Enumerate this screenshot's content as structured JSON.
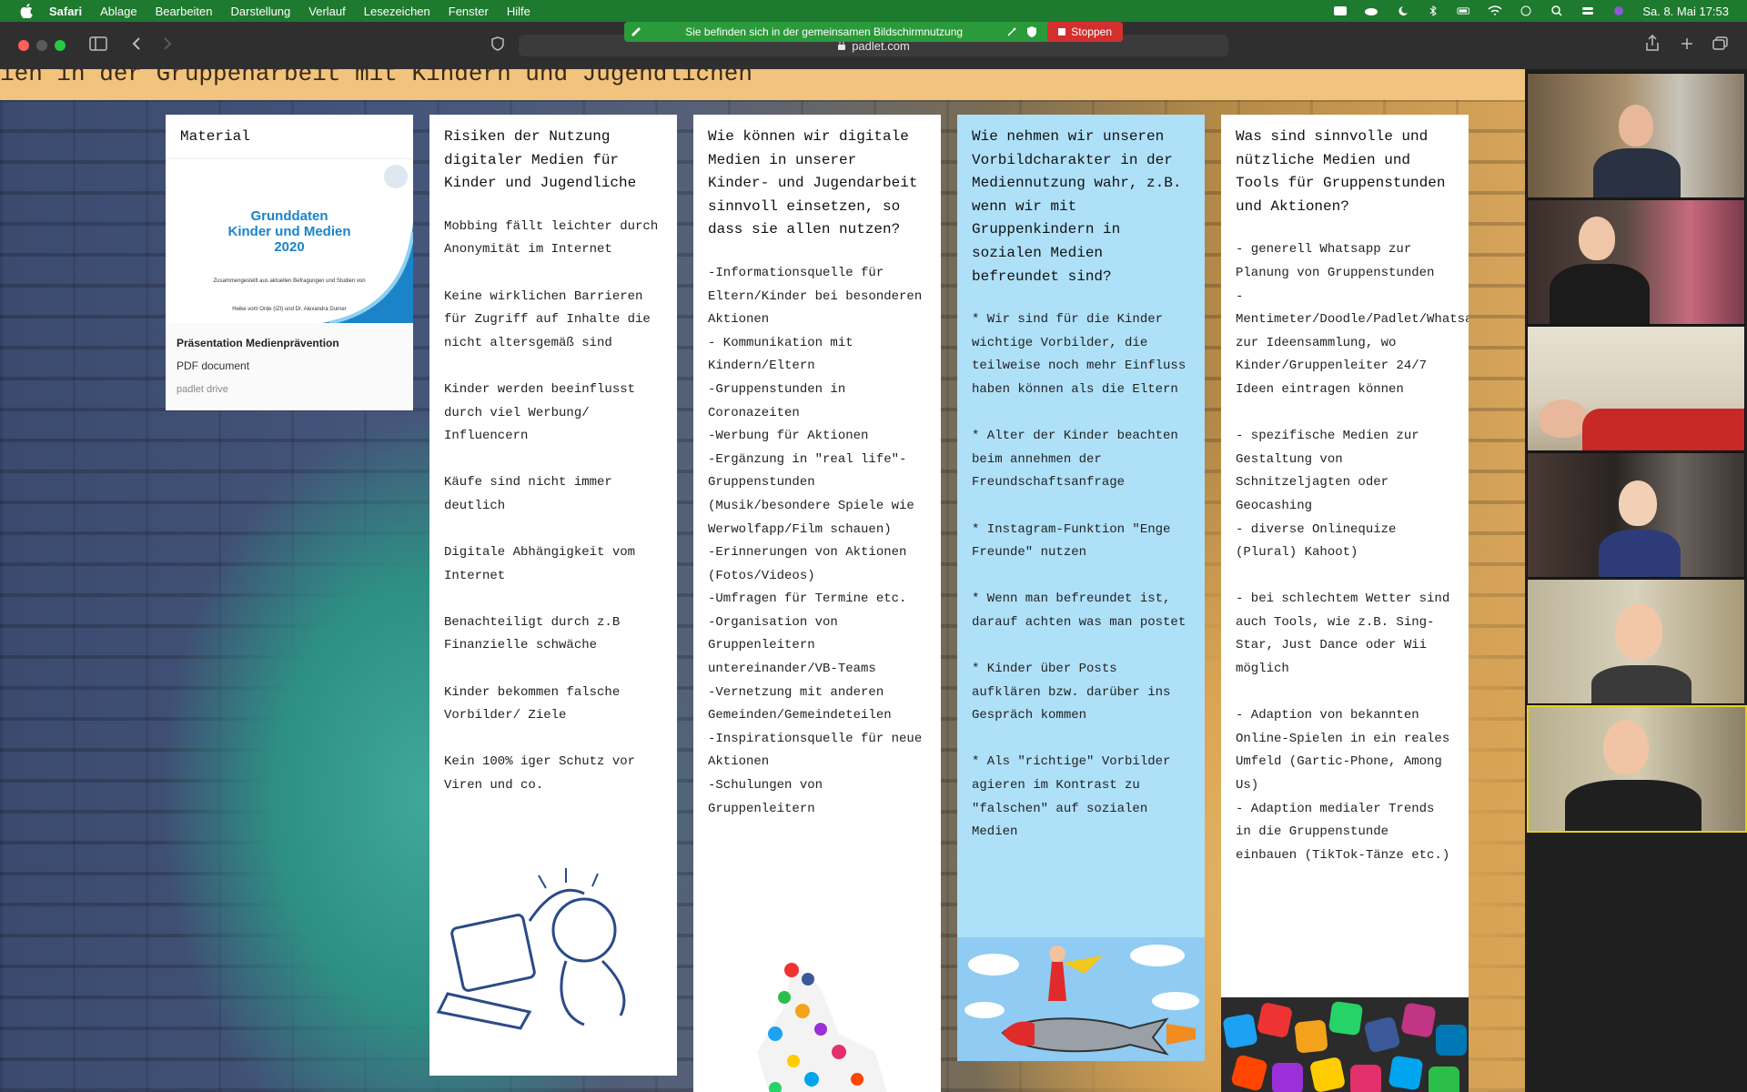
{
  "menubar": {
    "app": "Safari",
    "items": [
      "Ablage",
      "Bearbeiten",
      "Darstellung",
      "Verlauf",
      "Lesezeichen",
      "Fenster",
      "Hilfe"
    ],
    "datetime": "Sa. 8. Mai  17:53"
  },
  "share_banner": {
    "text": "Sie befinden sich in der gemeinsamen Bildschirmnutzung",
    "stop_label": "Stoppen"
  },
  "browser": {
    "url": "padlet.com"
  },
  "padlet": {
    "title": "ien in der Gruppenarbeit mit Kindern und Jugendlichen",
    "material": {
      "title": "Material",
      "pdf_title_line1": "Grunddaten",
      "pdf_title_line2": "Kinder und Medien",
      "pdf_title_line3": "2020",
      "pdf_subtitle": "Zusammengestellt aus aktuellen Befragungen und Studien von",
      "pdf_authors": "Heike vom Orde (IZI) und Dr. Alexandra Durner",
      "file_name": "Präsentation Medienprävention",
      "file_type": "PDF document",
      "file_source": "padlet drive"
    },
    "columns": [
      {
        "title": "Risiken der Nutzung digitaler Medien für Kinder und Jugendliche",
        "body": "Mobbing fällt leichter durch Anonymität im Internet\n\nKeine wirklichen Barrieren  für Zugriff auf Inhalte die nicht altersgemäß sind\n\nKinder werden beeinflusst durch viel Werbung/ Influencern\n\nKäufe sind nicht immer deutlich\n\nDigitale Abhängigkeit vom Internet\n\nBenachteiligt durch z.B Finanzielle schwäche\n\nKinder bekommen falsche Vorbilder/ Ziele\n\nKein 100% iger Schutz vor Viren und co."
      },
      {
        "title": "Wie können wir digitale Medien in unserer Kinder- und Jugendarbeit sinnvoll einsetzen, so dass sie allen nutzen?",
        "body": "-Informationsquelle für Eltern/Kinder bei besonderen Aktionen\n- Kommunikation mit Kindern/Eltern\n-Gruppenstunden in Coronazeiten\n-Werbung für Aktionen\n-Ergänzung in \"real life\"-Gruppenstunden (Musik/besondere Spiele wie Werwolfapp/Film schauen)\n-Erinnerungen von Aktionen (Fotos/Videos)\n-Umfragen für Termine etc.\n-Organisation von Gruppenleitern untereinander/VB-Teams\n-Vernetzung mit anderen Gemeinden/Gemeindeteilen\n-Inspirationsquelle für neue Aktionen\n-Schulungen von Gruppenleitern"
      },
      {
        "title": "Wie nehmen wir unseren Vorbildcharakter in der Mediennutzung wahr, z.B. wenn wir mit Gruppenkindern in sozialen Medien befreundet sind?",
        "body": "* Wir sind für die Kinder wichtige Vorbilder, die teilweise noch mehr Einfluss haben können als die Eltern\n\n* Alter der Kinder beachten beim annehmen der Freundschaftsanfrage\n\n* Instagram-Funktion \"Enge Freunde\" nutzen\n\n* Wenn man befreundet ist, darauf achten was man postet\n\n* Kinder über Posts aufklären bzw. darüber ins Gespräch kommen\n\n* Als \"richtige\" Vorbilder agieren im Kontrast zu \"falschen\" auf sozialen Medien"
      },
      {
        "title": "Was sind sinnvolle und nützliche Medien und Tools für Gruppenstunden und Aktionen?",
        "body": "- generell Whatsapp zur Planung von Gruppenstunden\n- Mentimeter/Doodle/Padlet/Whatsapp zur Ideensammlung, wo Kinder/Gruppenleiter 24/7 Ideen eintragen können\n\n- spezifische Medien zur Gestaltung von Schnitzeljagten oder Geocashing\n- diverse Onlinequize (Plural) Kahoot)\n\n- bei schlechtem Wetter sind auch Tools, wie z.B. Sing-Star, Just Dance oder Wii möglich\n\n- Adaption von bekannten Online-Spielen in ein reales Umfeld (Gartic-Phone, Among Us)\n- Adaption medialer Trends in die Gruppenstunde einbauen (TikTok-Tänze etc.)"
      }
    ]
  },
  "colors": {
    "menubar_bg": "#1e7a2e",
    "banner_bg": "#2a9a3a",
    "stop_bg": "#d32f2f",
    "card_blue": "#aee0f8",
    "pdf_title": "#1b84c9",
    "active_speaker": "#e7d21a"
  }
}
